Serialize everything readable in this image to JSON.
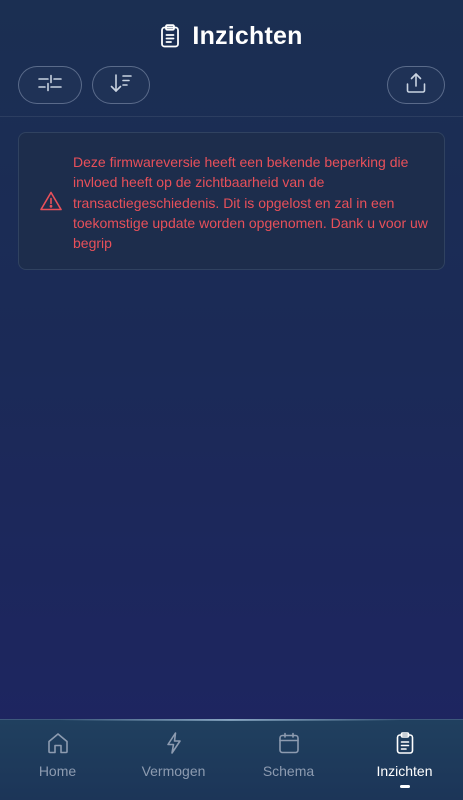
{
  "header": {
    "title": "Inzichten",
    "title_icon": "clipboard-icon"
  },
  "toolbar": {
    "filter_icon": "sliders-icon",
    "sort_icon": "sort-descending-icon",
    "share_icon": "upload-icon"
  },
  "warning": {
    "icon": "warning-triangle-icon",
    "text": "Deze firmwareversie heeft een bekende beperking die invloed heeft op de zichtbaarheid van de transactiegeschiedenis. Dit is opgelost en zal in een toekomstige update worden opgenomen. Dank u voor uw begrip",
    "color": "#e8505a"
  },
  "tabs": [
    {
      "label": "Home",
      "icon": "home-icon",
      "active": false
    },
    {
      "label": "Vermogen",
      "icon": "lightning-icon",
      "active": false
    },
    {
      "label": "Schema",
      "icon": "calendar-icon",
      "active": false
    },
    {
      "label": "Inzichten",
      "icon": "clipboard-icon",
      "active": true
    }
  ],
  "colors": {
    "background_top": "#1b2f52",
    "background_bottom": "#1e2462",
    "card": "#1d2d4c",
    "tab_inactive": "#8d9bb0",
    "tab_active": "#ffffff"
  }
}
